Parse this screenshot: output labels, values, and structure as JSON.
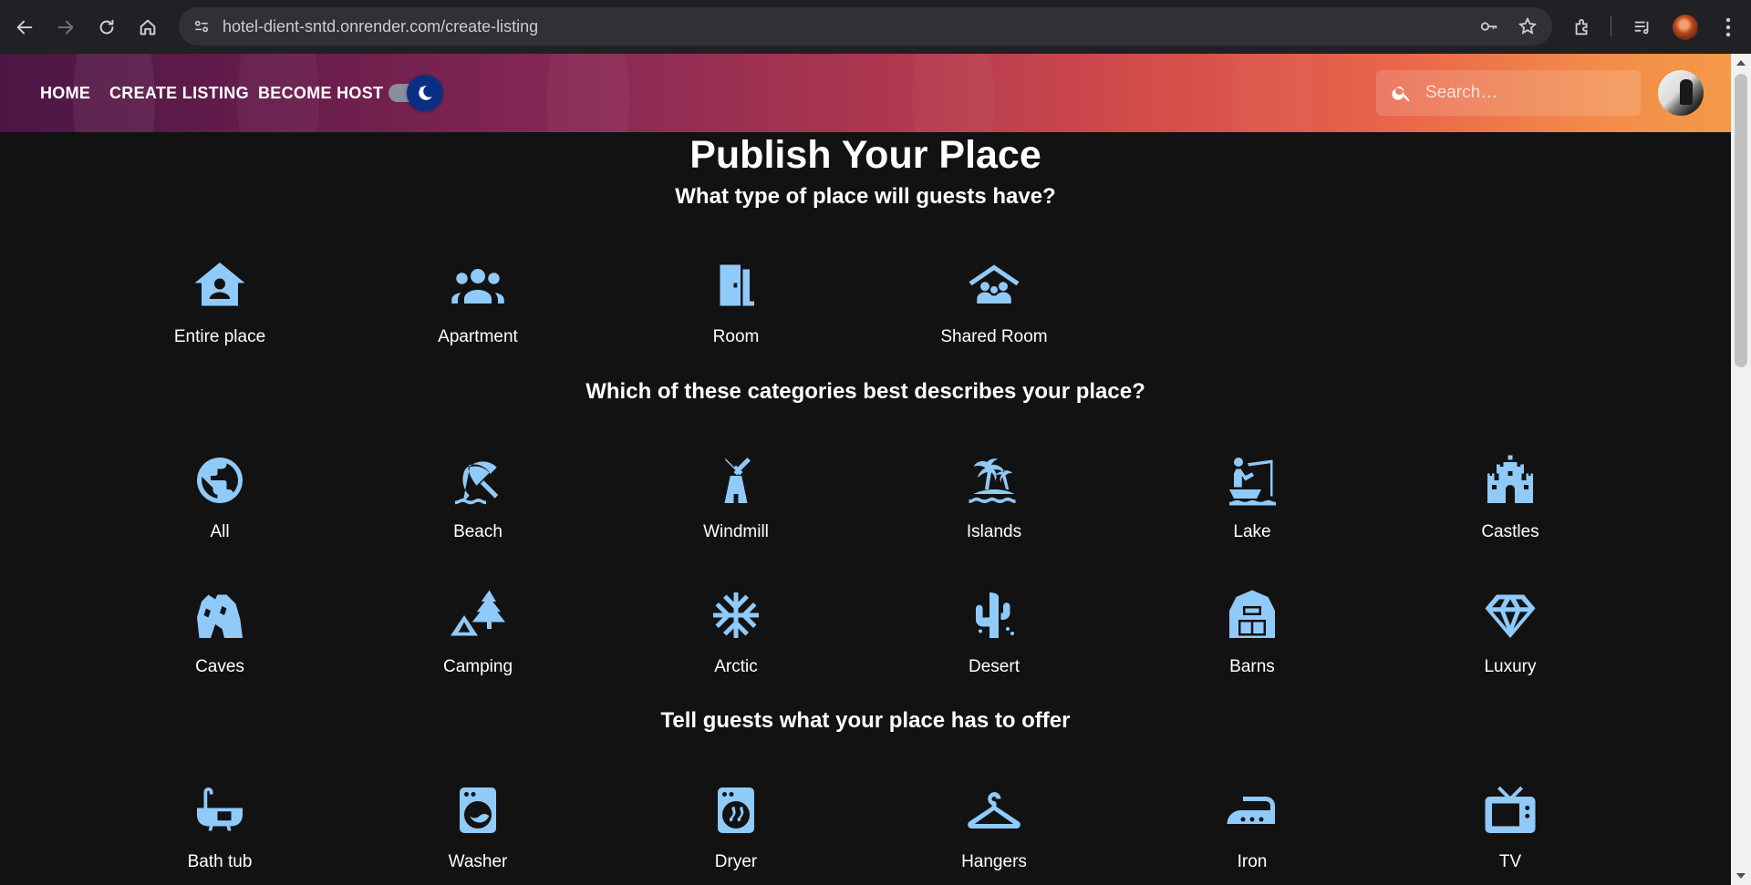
{
  "browser": {
    "url": "hotel-dient-sntd.onrender.com/create-listing"
  },
  "header": {
    "nav": [
      "HOME",
      "CREATE LISTING",
      "BECOME HOST"
    ],
    "search_placeholder": "Search…",
    "theme": "dark",
    "colors": {
      "gradient_start": "#4a1745",
      "gradient_end": "#f59a48",
      "toggle_thumb": "#0b2e85"
    }
  },
  "page": {
    "title": "Publish Your Place",
    "place_type_heading": "What type of place will guests have?",
    "place_types": [
      {
        "label": "Entire place",
        "icon": "house-person-icon"
      },
      {
        "label": "Apartment",
        "icon": "group-icon"
      },
      {
        "label": "Room",
        "icon": "door-icon"
      },
      {
        "label": "Shared Room",
        "icon": "shared-roof-icon"
      }
    ],
    "categories_heading": "Which of these categories best describes your place?",
    "categories": [
      {
        "label": "All",
        "icon": "globe-icon"
      },
      {
        "label": "Beach",
        "icon": "umbrella-beach-icon"
      },
      {
        "label": "Windmill",
        "icon": "windmill-icon"
      },
      {
        "label": "Islands",
        "icon": "palm-island-icon"
      },
      {
        "label": "Lake",
        "icon": "fishing-boat-icon"
      },
      {
        "label": "Castles",
        "icon": "castle-icon"
      },
      {
        "label": "Caves",
        "icon": "cave-icon"
      },
      {
        "label": "Camping",
        "icon": "tent-tree-icon"
      },
      {
        "label": "Arctic",
        "icon": "snowflake-icon"
      },
      {
        "label": "Desert",
        "icon": "cactus-icon"
      },
      {
        "label": "Barns",
        "icon": "barn-icon"
      },
      {
        "label": "Luxury",
        "icon": "diamond-icon"
      }
    ],
    "amenities_heading": "Tell guests what your place has to offer",
    "amenities": [
      {
        "label": "Bath tub",
        "icon": "bathtub-icon"
      },
      {
        "label": "Washer",
        "icon": "washer-icon"
      },
      {
        "label": "Dryer",
        "icon": "dryer-icon"
      },
      {
        "label": "Hangers",
        "icon": "hanger-icon"
      },
      {
        "label": "Iron",
        "icon": "iron-icon"
      },
      {
        "label": "TV",
        "icon": "tv-icon"
      }
    ],
    "icon_color": "#90caf9"
  }
}
